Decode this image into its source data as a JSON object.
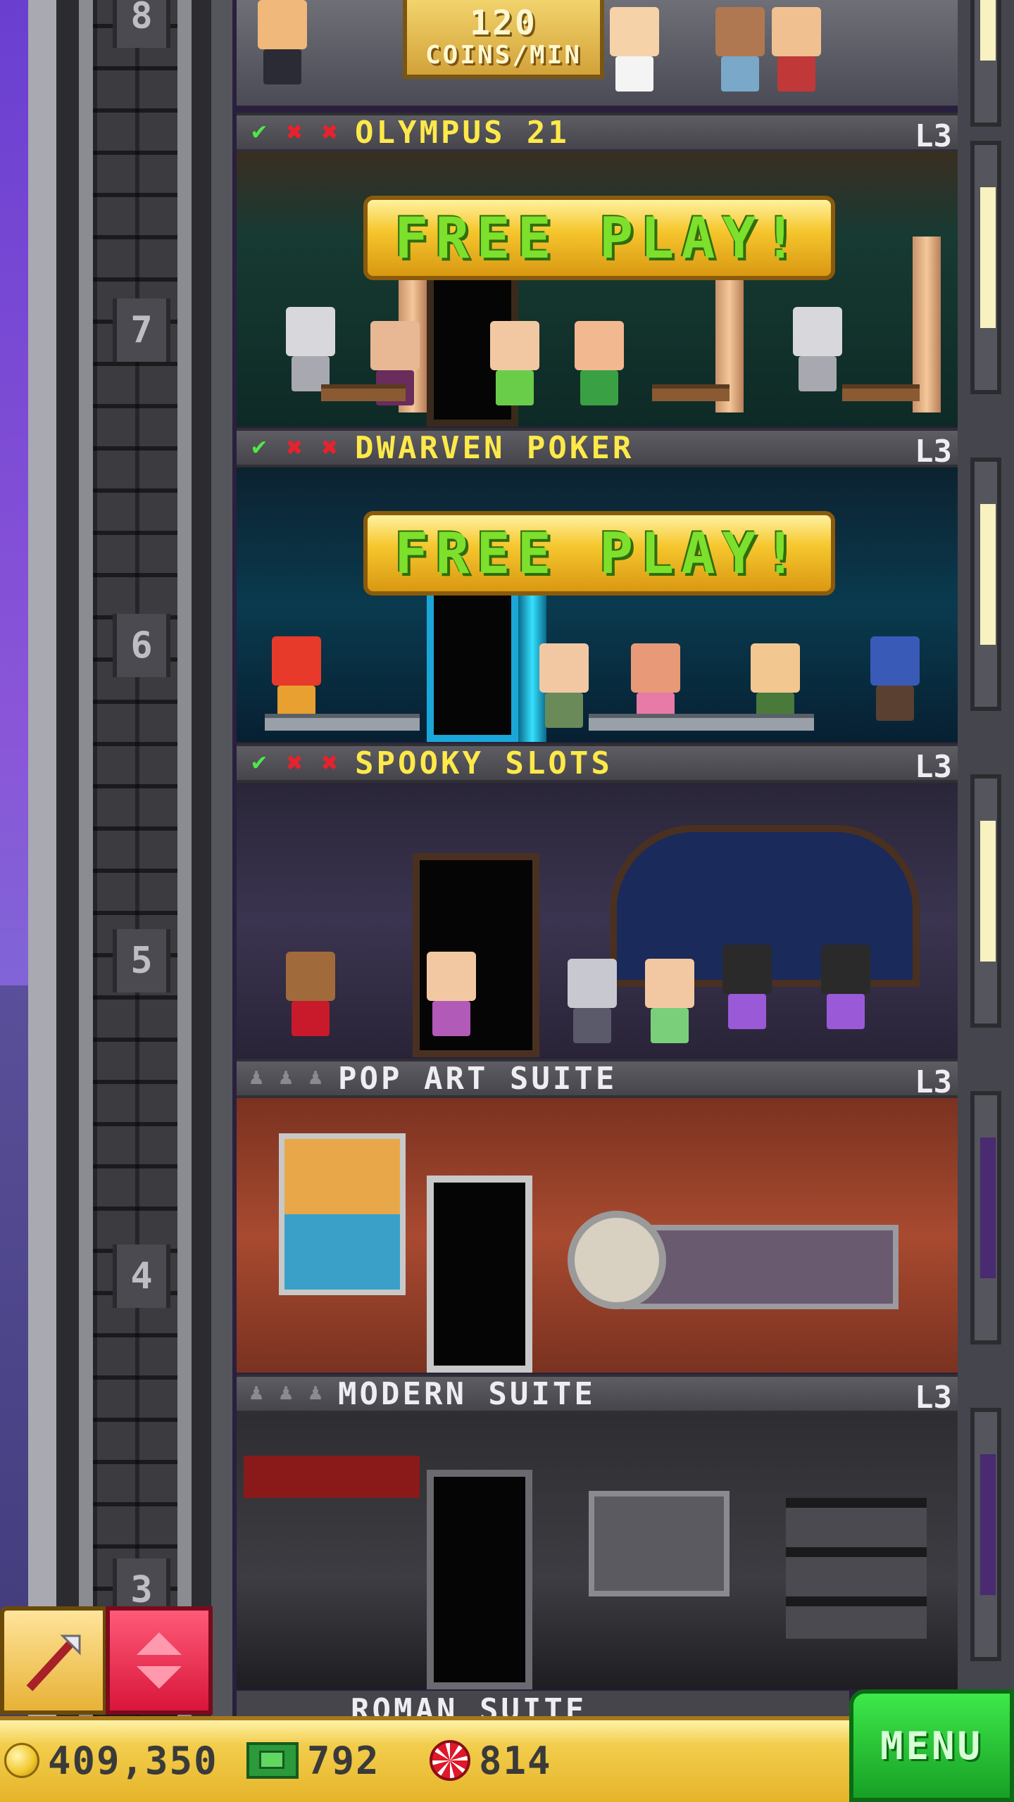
{
  "top_floor": {
    "floor_number": "8",
    "income_amount": "120",
    "income_unit": "COINS/MIN"
  },
  "floors": [
    {
      "floor_number": "7",
      "name": "OLYMPUS 21",
      "level": "L3",
      "stock_marks": [
        "check",
        "x",
        "x"
      ],
      "action": "FREE  PLAY!"
    },
    {
      "floor_number": "6",
      "name": "DWARVEN POKER",
      "level": "L3",
      "stock_marks": [
        "check",
        "x",
        "x"
      ],
      "action": "FREE  PLAY!"
    },
    {
      "floor_number": "5",
      "name": "SPOOKY SLOTS",
      "level": "L3",
      "stock_marks": [
        "check",
        "x",
        "x"
      ]
    },
    {
      "floor_number": "4",
      "name": "POP ART SUITE",
      "level": "L3",
      "residents": 0
    },
    {
      "floor_number": "3",
      "name": "MODERN SUITE",
      "level": "L3",
      "residents": 0
    }
  ],
  "partial_floor_name": "ROMAN SUITE",
  "status_bar": {
    "coins": "409,350",
    "bux": "792",
    "chips": "814",
    "menu_label": "MENU"
  },
  "icons": {
    "check": "✔",
    "x": "✖",
    "person": "♟",
    "build": "hammer-icon",
    "elevator": "up-down-arrows-icon"
  },
  "colors": {
    "casino_title": "#ffe94a",
    "suite_title": "#eeeef2",
    "menu_green": "#17a025",
    "gold_bar": "#f2cd4c",
    "elevator_red": "#d8163a"
  }
}
